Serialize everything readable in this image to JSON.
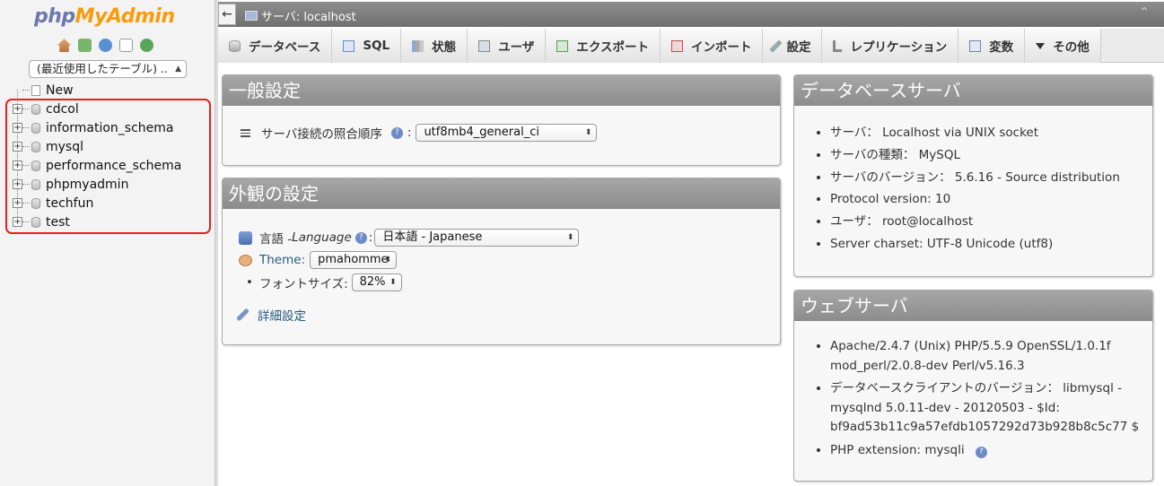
{
  "nav": {
    "logo_php": "php",
    "logo_myadmin": "MyAdmin",
    "icons": [
      "home-icon",
      "logout-icon",
      "help-icon",
      "docs-icon",
      "reload-icon"
    ],
    "recent_tables": "(最近使用したテーブル) ..",
    "new_label": "New",
    "databases": [
      "cdcol",
      "information_schema",
      "mysql",
      "performance_schema",
      "phpmyadmin",
      "techfun",
      "test"
    ],
    "highlight_color": "#e8211b"
  },
  "topbar": {
    "back_glyph": "←",
    "server_label": "サーバ: localhost",
    "collapse_glyph": "⌃"
  },
  "tabs": [
    {
      "label": "データベース",
      "icon": "database-icon"
    },
    {
      "label": "SQL",
      "icon": "sql-icon"
    },
    {
      "label": "状態",
      "icon": "status-icon"
    },
    {
      "label": "ユーザ",
      "icon": "user-icon"
    },
    {
      "label": "エクスポート",
      "icon": "export-icon"
    },
    {
      "label": "インポート",
      "icon": "import-icon"
    },
    {
      "label": "設定",
      "icon": "settings-icon"
    },
    {
      "label": "レプリケーション",
      "icon": "replication-icon"
    },
    {
      "label": "変数",
      "icon": "variables-icon"
    },
    {
      "label": "その他",
      "icon": "more-icon"
    }
  ],
  "general": {
    "title": "一般設定",
    "collation_label": "サーバ接続の照合順序",
    "collation_colon": ":",
    "collation_value": "utf8mb4_general_ci"
  },
  "appearance": {
    "title": "外観の設定",
    "language_label": "言語 - ",
    "language_label_en": "Language",
    "language_colon": ":",
    "language_value": "日本語 - Japanese",
    "theme_label": "Theme:",
    "theme_value": "pmahomme",
    "fontsize_bullet": "•",
    "fontsize_label": "フォントサイズ:",
    "fontsize_value": "82%",
    "more_settings": "詳細設定"
  },
  "db_server": {
    "title": "データベースサーバ",
    "items": [
      "サーバ： Localhost via UNIX socket",
      "サーバの種類： MySQL",
      "サーバのバージョン： 5.6.16 - Source distribution",
      "Protocol version: 10",
      "ユーザ： root@localhost",
      "Server charset: UTF-8 Unicode (utf8)"
    ]
  },
  "web_server": {
    "title": "ウェブサーバ",
    "apache_line1": "Apache/2.4.7 (Unix) PHP/5.5.9 OpenSSL/1.0.1f",
    "apache_line2": "mod_perl/2.0.8-dev Perl/v5.16.3",
    "client_line1": "データベースクライアントのバージョン： libmysql -",
    "client_line2": "mysqlnd 5.0.11-dev - 20120503 - $Id:",
    "client_line3": "bf9ad53b11c9a57efdb1057292d73b928b8c5c77 $",
    "php_ext": "PHP extension: mysqli"
  }
}
